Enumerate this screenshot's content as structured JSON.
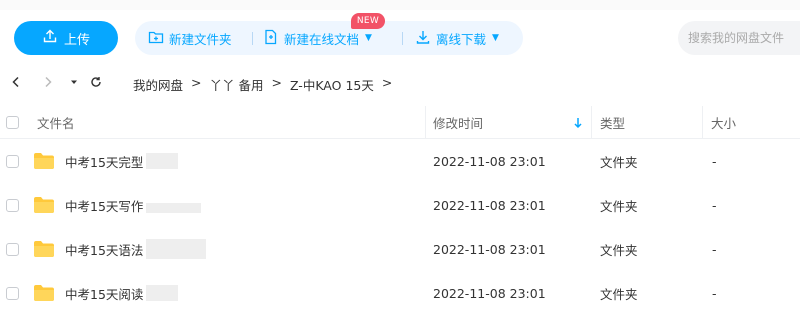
{
  "toolbar": {
    "upload_label": "上传",
    "new_folder_label": "新建文件夹",
    "new_online_doc_label": "新建在线文档",
    "new_badge": "NEW",
    "offline_download_label": "离线下载",
    "search_placeholder": "搜索我的网盘文件"
  },
  "breadcrumb": {
    "items": [
      "我的网盘",
      "丫丫 备用",
      "Z-中KAO 15天"
    ],
    "separator": ">"
  },
  "table": {
    "headers": {
      "name": "文件名",
      "modified": "修改时间",
      "type": "类型",
      "size": "大小"
    },
    "sort_column": "modified",
    "rows": [
      {
        "name": "中考15天完型",
        "modified": "2022-11-08 23:01",
        "type": "文件夹",
        "size": "-"
      },
      {
        "name": "中考15天写作",
        "modified": "2022-11-08 23:01",
        "type": "文件夹",
        "size": "-"
      },
      {
        "name": "中考15天语法",
        "modified": "2022-11-08 23:01",
        "type": "文件夹",
        "size": "-"
      },
      {
        "name": "中考15天阅读",
        "modified": "2022-11-08 23:01",
        "type": "文件夹",
        "size": "-"
      }
    ]
  },
  "colors": {
    "accent": "#06a7ff",
    "badge": "#f25267",
    "folder": "#ffc93b"
  },
  "icons": {
    "upload": "upload-icon",
    "new_folder": "new-folder-icon",
    "new_doc": "new-doc-icon",
    "download": "download-icon",
    "back": "chevron-left-icon",
    "forward": "chevron-right-icon",
    "history": "caret-down-icon",
    "refresh": "refresh-icon",
    "folder": "folder-icon",
    "sort": "sort-down-icon"
  }
}
